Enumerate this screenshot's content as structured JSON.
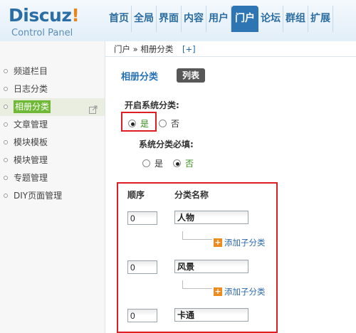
{
  "brand": {
    "logo_word": "Discuz",
    "logo_bang": "!",
    "subtitle": "Control Panel"
  },
  "topnav": [
    "首页",
    "全局",
    "界面",
    "内容",
    "用户",
    "门户",
    "论坛",
    "群组",
    "扩展"
  ],
  "topnav_active_index": 5,
  "sidebar": {
    "items": [
      {
        "label": "频道栏目"
      },
      {
        "label": "日志分类"
      },
      {
        "label": "相册分类"
      },
      {
        "label": "文章管理"
      },
      {
        "label": "模块模板"
      },
      {
        "label": "模块管理"
      },
      {
        "label": "专题管理"
      },
      {
        "label": "DIY页面管理"
      }
    ],
    "active_index": 2
  },
  "breadcrumb": {
    "text": "门户 » 相册分类",
    "action": "[+]"
  },
  "main": {
    "title": "相册分类",
    "list_tab": "列表",
    "enable_label": "开启系统分类:",
    "enable_yes": "是",
    "enable_no": "否",
    "enable_value": "是",
    "required_label": "系统分类必填:",
    "required_yes": "是",
    "required_no": "否",
    "required_value": "否",
    "table": {
      "col_order": "顺序",
      "col_name": "分类名称",
      "add_sub_label": "添加子分类",
      "rows": [
        {
          "order": "0",
          "name": "人物"
        },
        {
          "order": "0",
          "name": "风景"
        },
        {
          "order": "0",
          "name": "卡通"
        }
      ]
    }
  },
  "colors": {
    "accent": "#2e76b3",
    "active_green": "#6fb937",
    "highlight_red": "#de1d24",
    "add_orange": "#ee8b1f"
  }
}
